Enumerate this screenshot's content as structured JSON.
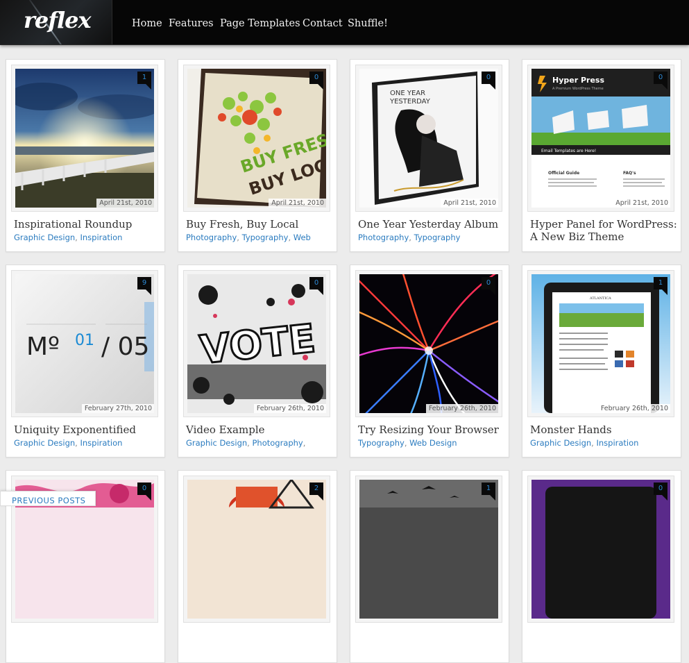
{
  "logo": "reflex",
  "nav": [
    {
      "label": "Home"
    },
    {
      "label": "Features"
    },
    {
      "label": "Page Templates"
    },
    {
      "label": "Contact"
    },
    {
      "label": "Shuffle!"
    }
  ],
  "posts": [
    {
      "title": "Inspirational Roundup",
      "date": "April 21st, 2010",
      "comments": "1",
      "categories": [
        "Graphic Design",
        "Inspiration"
      ]
    },
    {
      "title": "Buy Fresh, Buy Local",
      "date": "April 21st, 2010",
      "comments": "0",
      "categories": [
        "Photography",
        "Typography",
        "Web"
      ]
    },
    {
      "title": "One Year Yesterday Album",
      "date": "April 21st, 2010",
      "comments": "0",
      "categories": [
        "Photography",
        "Typography"
      ]
    },
    {
      "title": "Hyper Panel for WordPress: A New Biz Theme",
      "date": "April 21st, 2010",
      "comments": "0",
      "categories": []
    },
    {
      "title": "Uniquity Exponentified",
      "date": "February 27th, 2010",
      "comments": "9",
      "categories": [
        "Graphic Design",
        "Inspiration"
      ]
    },
    {
      "title": "Video Example",
      "date": "February 26th, 2010",
      "comments": "0",
      "categories": [
        "Graphic Design",
        "Photography"
      ]
    },
    {
      "title": "Try Resizing Your Browser",
      "date": "February 26th, 2010",
      "comments": "0",
      "categories": [
        "Typography",
        "Web Design"
      ]
    },
    {
      "title": "Monster Hands",
      "date": "February 26th, 2010",
      "comments": "1",
      "categories": [
        "Graphic Design",
        "Inspiration"
      ]
    },
    {
      "title": "",
      "date": "",
      "comments": "0",
      "categories": []
    },
    {
      "title": "",
      "date": "",
      "comments": "2",
      "categories": []
    },
    {
      "title": "",
      "date": "",
      "comments": "1",
      "categories": []
    },
    {
      "title": "",
      "date": "",
      "comments": "0",
      "categories": []
    }
  ],
  "thumb_text": {
    "buy_fresh": "BUY FRESH",
    "buy_local": "BUY LOCAL",
    "one_year": "ONE YEAR",
    "yesterday": "YESTERDAY",
    "hyper_press": "Hyper Press",
    "hyper_sub": "A Premium WordPress Theme",
    "hyper_banner": "Email Templates are Here!",
    "hyper_guide": "Official Guide",
    "hyper_faq": "FAQ's",
    "mo": "Mº",
    "mo_num": "01",
    "mo_den": "/ 05",
    "vote": "VOTE",
    "atlantica": "ATLANTICA"
  },
  "pagination": {
    "previous_label": "PREVIOUS POSTS"
  },
  "colors": {
    "header_bg": "#060606",
    "link": "#2a7bbf",
    "badge_number": "#2d8ad6",
    "page_bg": "#ececec"
  }
}
